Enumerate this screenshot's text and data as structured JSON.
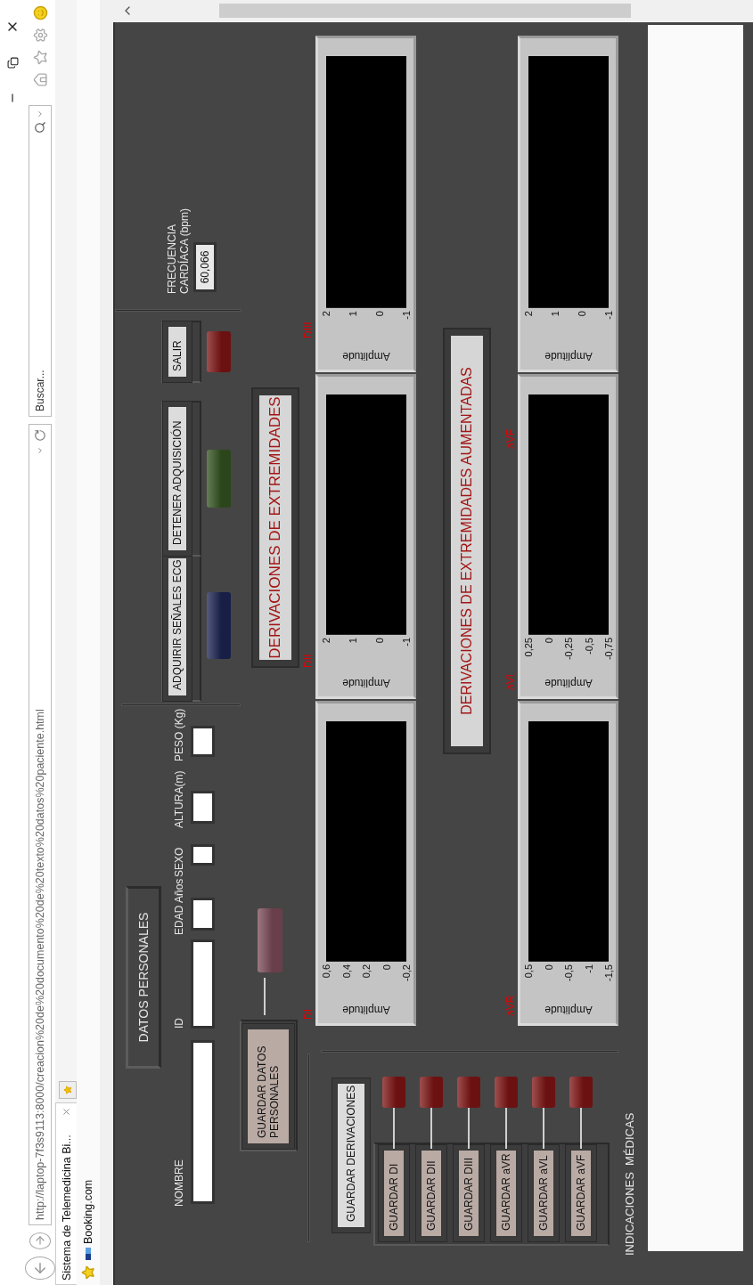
{
  "address_bar": {
    "url": "http://laptop-7f3s9113:8000/creacion%20de%20documento%20de%20texto%20datos%20paciente.html"
  },
  "search_box": {
    "placeholder": "Buscar..."
  },
  "tabs": [
    {
      "label": "Sistema de Telemedicina Bi...",
      "selected": true
    }
  ],
  "favorites": [
    {
      "label": "Booking.com"
    }
  ],
  "panel": {
    "personal_title": "DATOS PERSONALES",
    "fields": [
      {
        "label": "NOMBRE"
      },
      {
        "label": "ID"
      },
      {
        "label": "EDAD Años"
      },
      {
        "label": "SEXO"
      },
      {
        "label": "ALTURA(m)"
      },
      {
        "label": "PESO (Kg)"
      }
    ],
    "save_personal": {
      "label": "GUARDAR DATOS PERSONALES",
      "led_on": false
    },
    "acquisition_controls": [
      {
        "label": "ADQUIRIR SEÑALES ECG",
        "led_on": false
      },
      {
        "label": "DETENER ADQUISICIÓN",
        "led_on": false
      },
      {
        "label": "SALIR",
        "led_on": false
      }
    ],
    "heart_rate": {
      "label": "FRECUENCIA CARDÍACA  (bpm)",
      "value": "60,066"
    },
    "limb_leads_title": "DERIVACIONES DE EXTREMIDADES",
    "augmented_leads_title": "DERIVACIONES DE EXTREMIDADES AUMENTADAS",
    "graphs": [
      {
        "lead": "DI",
        "y_label": "Amplitude",
        "y_ticks": [
          "0,6",
          "0,4",
          "0,2",
          "0",
          "-0,2"
        ]
      },
      {
        "lead": "DII",
        "y_label": "Amplitude",
        "y_ticks": [
          "2",
          "1",
          "0",
          "-1"
        ]
      },
      {
        "lead": "DIII",
        "y_label": "Amplitude",
        "y_ticks": [
          "2",
          "1",
          "0",
          "-1"
        ]
      },
      {
        "lead": "aVR",
        "y_label": "Amplitude",
        "y_ticks": [
          "0,5",
          "0",
          "-0,5",
          "-1",
          "-1,5"
        ]
      },
      {
        "lead": "aVL",
        "y_label": "Amplitude",
        "y_ticks": [
          "0,25",
          "0",
          "-0,25",
          "-0,5",
          "-0,75"
        ]
      },
      {
        "lead": "aVF",
        "y_label": "Amplitude",
        "y_ticks": [
          "2",
          "1",
          "0",
          "-1"
        ]
      }
    ],
    "save_leads_title": "GUARDAR DERIVACIONES",
    "save_lead_buttons": [
      {
        "label": "GUARDAR DI",
        "led_on": false
      },
      {
        "label": "GUARDAR DII",
        "led_on": false
      },
      {
        "label": "GUARDAR DIII",
        "led_on": false
      },
      {
        "label": "GUARDAR aVR",
        "led_on": false
      },
      {
        "label": "GUARDAR aVL",
        "led_on": false
      },
      {
        "label": "GUARDAR aVF",
        "led_on": false
      }
    ],
    "notes_label": "INDICACIONES  MÉDICAS"
  }
}
